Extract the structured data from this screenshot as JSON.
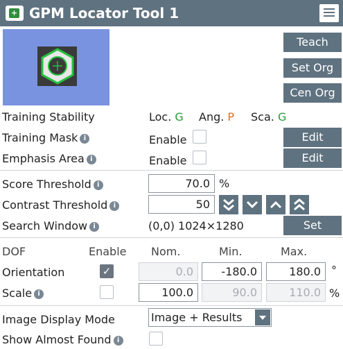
{
  "title": "GPM Locator Tool 1",
  "buttons": {
    "teach": "Teach",
    "set_org": "Set Org",
    "cen_org": "Cen Org",
    "edit_mask": "Edit",
    "edit_emphasis": "Edit",
    "set_window": "Set"
  },
  "stability": {
    "label": "Training Stability",
    "loc_label": "Loc.",
    "loc_value": "G",
    "ang_label": "Ang.",
    "ang_value": "P",
    "sca_label": "Sca.",
    "sca_value": "G"
  },
  "mask": {
    "label": "Training Mask",
    "enable_label": "Enable",
    "enabled": false
  },
  "emphasis": {
    "label": "Emphasis Area",
    "enable_label": "Enable",
    "enabled": false
  },
  "score": {
    "label": "Score Threshold",
    "value": "70.0",
    "unit": "%"
  },
  "contrast": {
    "label": "Contrast Threshold",
    "value": "50"
  },
  "search": {
    "label": "Search Window",
    "value": "(0,0) 1024×1280"
  },
  "dof": {
    "headers": {
      "dof": "DOF",
      "enable": "Enable",
      "nom": "Nom.",
      "min": "Min.",
      "max": "Max."
    },
    "orientation": {
      "label": "Orientation",
      "enabled": true,
      "nom": "0.0",
      "min": "-180.0",
      "max": "180.0",
      "unit": "°"
    },
    "scale": {
      "label": "Scale",
      "enabled": false,
      "nom": "100.0",
      "min": "90.0",
      "max": "110.0",
      "unit": "%"
    }
  },
  "display_mode": {
    "label": "Image Display Mode",
    "value": "Image + Results"
  },
  "almost_found": {
    "label": "Show Almost Found",
    "enabled": false
  }
}
